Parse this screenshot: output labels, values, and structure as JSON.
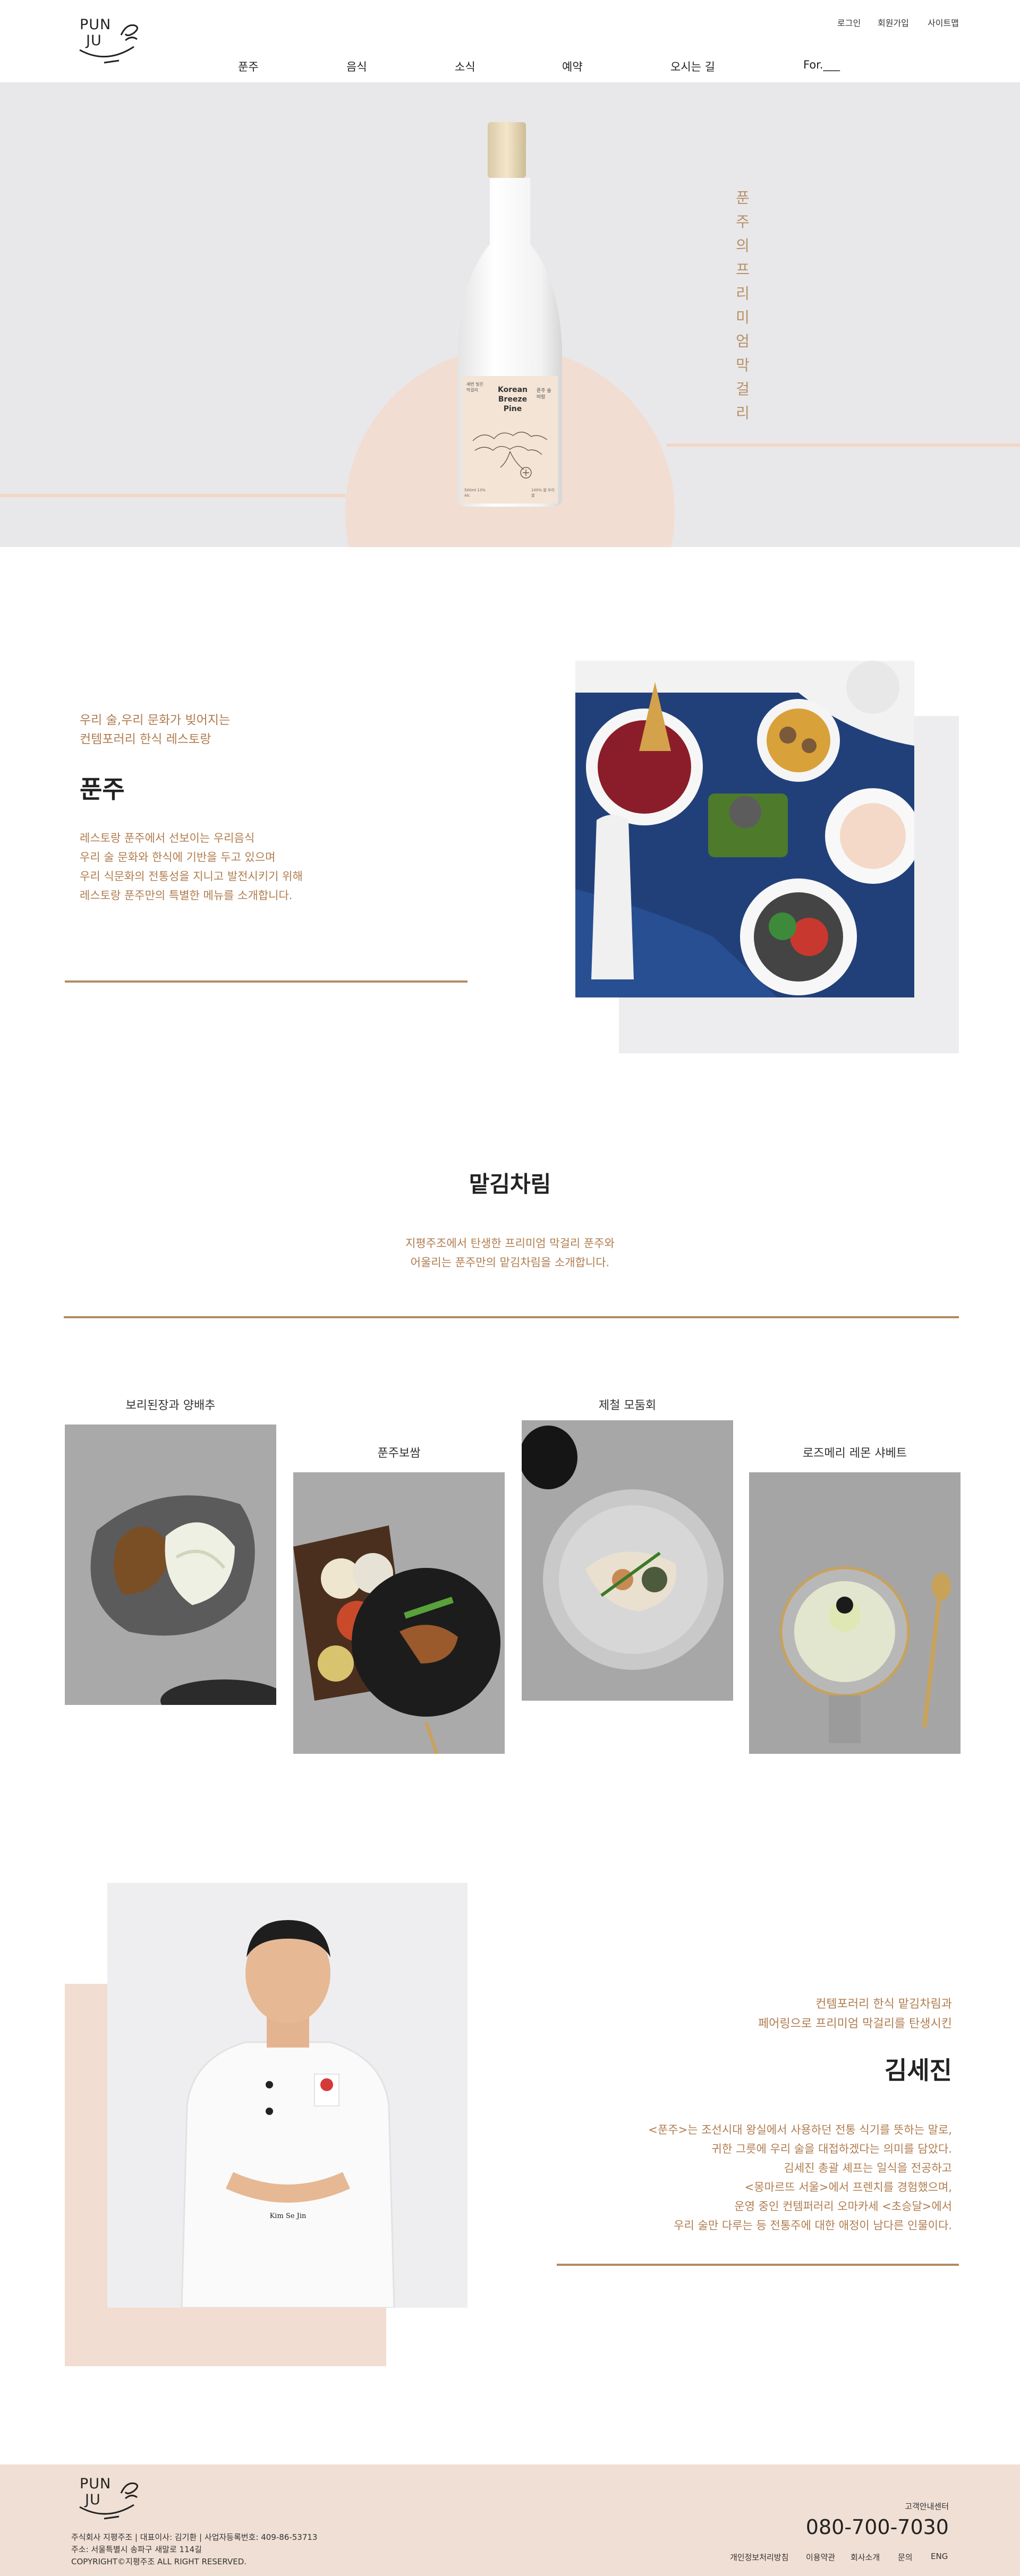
{
  "header": {
    "logo": {
      "line1": "PUN",
      "line2": "JU"
    },
    "util_links": [
      "로그인",
      "회원가입",
      "사이트맵"
    ],
    "nav": [
      "푼주",
      "음식",
      "소식",
      "예약",
      "오시는 길",
      "For.___"
    ]
  },
  "hero": {
    "vertical_title": "푼주의 프리미엄 막걸리",
    "label": {
      "brand": "Korean Breeze Pine",
      "side_left": "세번 빚은 막걸리",
      "side_right": "푼주 솔바람",
      "small_left": "500ml 13% Alc",
      "small_right": "100% 쌀 우리쌀"
    },
    "colors": {
      "bg": "#e8e8ea",
      "circle": "#f1ddd1",
      "line": "#f3d6c6"
    }
  },
  "intro": {
    "subtitle_lines": [
      "우리 술,우리 문화가 빚어지는",
      "컨템포러리 한식 레스토랑"
    ],
    "title": "푼주",
    "body_lines": [
      "레스토랑 푼주에서 선보이는 우리음식",
      "우리 술 문화와 한식에 기반을 두고 있으며",
      "우리 식문화의 전통성을 지니고 발전시키기 위해",
      "레스토랑 푼주만의 특별한 메뉴를 소개합니다."
    ]
  },
  "menu_section": {
    "title": "맡김차림",
    "desc_lines": [
      "지평주조에서 탄생한 프리미엄 막걸리 푼주와",
      "어울리는 푼주만의 맡김차림을 소개합니다."
    ],
    "items": [
      {
        "caption": "보리된장과 양배추"
      },
      {
        "caption": "푼주보쌈"
      },
      {
        "caption": "제철 모둠회"
      },
      {
        "caption": "로즈메리 레몬 샤베트"
      }
    ]
  },
  "chef": {
    "subtitle_lines": [
      "컨템포러리 한식 맡김차림과",
      "페어링으로 프리미엄 막걸리를 탄생시킨"
    ],
    "name": "김세진",
    "body_lines": [
      "<푼주>는 조선시대 왕실에서 사용하던 전통 식기를 뜻하는 말로,",
      "귀한 그릇에 우리 술을 대접하겠다는 의미를 담았다.",
      "김세진 총괄 셰프는 일식을 전공하고",
      "<몽마르뜨 서울>에서 프렌치를 경험했으며,",
      "운영 중인 컨템퍼러리 오마카세 <초승달>에서",
      "우리 술만 다루는 등 전통주에 대한 애정이 남다른 인물이다."
    ],
    "apron_text": "Kim Se Jin"
  },
  "footer": {
    "logo": {
      "line1": "PUN",
      "line2": "JU"
    },
    "info_lines": [
      "주식회사 지평주조 | 대표이사: 김기환 | 사업자등록번호: 409-86-53713",
      "주소: 서울특별시 송파구 새말로 114길",
      "COPYRIGHT©지평주조 ALL RIGHT RESERVED."
    ],
    "cs_label": "고객안내센터",
    "phone": "080-700-7030",
    "links": [
      "개인정보처리방침",
      "이용약관",
      "회사소개",
      "문의",
      "ENG"
    ]
  }
}
